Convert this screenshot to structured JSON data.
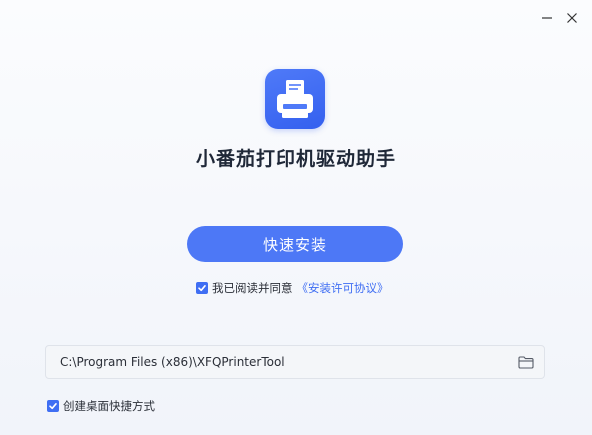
{
  "window": {
    "minimize_icon": "minimize-icon",
    "close_icon": "close-icon"
  },
  "app": {
    "title": "小番茄打印机驱动助手",
    "logo_icon": "printer-icon",
    "brand_color": "#3f6ef3"
  },
  "install": {
    "button_label": "快速安装"
  },
  "agreement": {
    "checked": true,
    "text": "我已阅读并同意",
    "link": "《安装许可协议》"
  },
  "install_path": {
    "value": "C:\\Program Files (x86)\\XFQPrinterTool",
    "browse_icon": "folder-icon"
  },
  "shortcut": {
    "checked": true,
    "label": "创建桌面快捷方式"
  }
}
